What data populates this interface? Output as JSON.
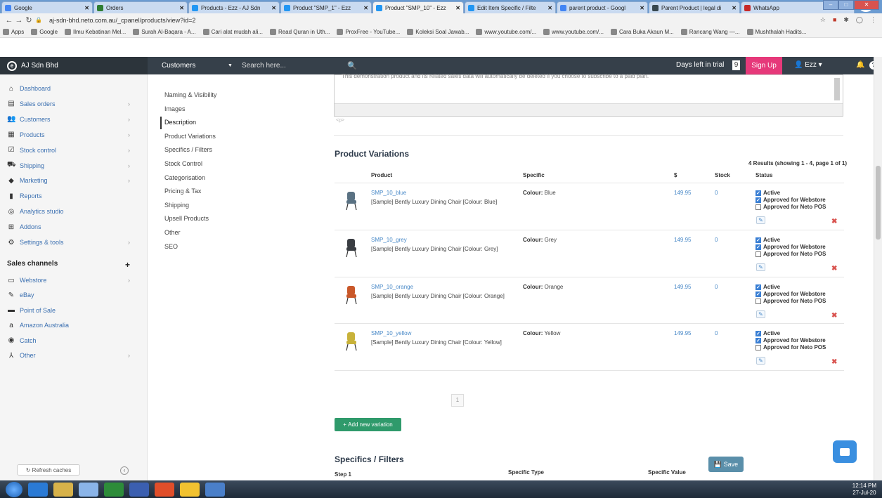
{
  "browser": {
    "tabs": [
      {
        "title": "Google",
        "color": "#4285f4"
      },
      {
        "title": "Orders",
        "color": "#2e7d32"
      },
      {
        "title": "Products - Ezz - AJ Sdn",
        "color": "#2196f3"
      },
      {
        "title": "Product \"SMP_1\" - Ezz",
        "color": "#2196f3"
      },
      {
        "title": "Product \"SMP_10\" - Ezz",
        "color": "#2196f3"
      },
      {
        "title": "Edit Item Specific / Filte",
        "color": "#2196f3"
      },
      {
        "title": "parent product - Googl",
        "color": "#4285f4"
      },
      {
        "title": "Parent Product | legal di",
        "color": "#37474f"
      },
      {
        "title": "WhatsApp",
        "color": "#c62828"
      }
    ],
    "url": "aj-sdn-bhd.neto.com.au/_cpanel/products/view?id=2",
    "bookmarks": [
      "Apps",
      "Google",
      "Ilmu Kebatinan Mel...",
      "Surah Al-Baqara - A...",
      "Cari alat mudah ali...",
      "Read Quran in Uth...",
      "ProxFree - YouTube...",
      "Koleksi Soal Jawab...",
      "www.youtube.com/...",
      "www.youtube.com/...",
      "Cara Buka Akaun M...",
      "Rancang Wang —...",
      "Mushthalah Hadits..."
    ]
  },
  "topnav": {
    "brand": "AJ Sdn Bhd",
    "scope": "Customers",
    "search_placeholder": "Search here...",
    "trial_label": "Days left in trial",
    "trial_days": "9",
    "signup": "Sign Up",
    "user": "Ezz"
  },
  "sidebar": {
    "items": [
      {
        "label": "Dashboard",
        "icon": "home-icon"
      },
      {
        "label": "Sales orders",
        "icon": "document-icon"
      },
      {
        "label": "Customers",
        "icon": "users-icon"
      },
      {
        "label": "Products",
        "icon": "box-icon"
      },
      {
        "label": "Stock control",
        "icon": "check-icon"
      },
      {
        "label": "Shipping",
        "icon": "truck-icon"
      },
      {
        "label": "Marketing",
        "icon": "tag-icon"
      },
      {
        "label": "Reports",
        "icon": "chart-icon"
      },
      {
        "label": "Analytics studio",
        "icon": "analytics-icon"
      },
      {
        "label": "Addons",
        "icon": "plus-square-icon"
      },
      {
        "label": "Settings & tools",
        "icon": "gear-icon"
      }
    ],
    "channels_heading": "Sales channels",
    "channels": [
      {
        "label": "Webstore",
        "icon": "store-icon"
      },
      {
        "label": "eBay",
        "icon": "ebay-icon"
      },
      {
        "label": "Point of Sale",
        "icon": "pos-icon"
      },
      {
        "label": "Amazon Australia",
        "icon": "amazon-icon"
      },
      {
        "label": "Catch",
        "icon": "catch-icon"
      },
      {
        "label": "Other",
        "icon": "other-icon"
      }
    ],
    "refresh": "Refresh caches"
  },
  "section_nav": [
    "Naming & Visibility",
    "Images",
    "Description",
    "Product Variations",
    "Specifics / Filters",
    "Stock Control",
    "Categorisation",
    "Pricing & Tax",
    "Shipping",
    "Upsell Products",
    "Other",
    "SEO"
  ],
  "editor": {
    "text": "This demonstration product and its related sales data will automatically be deleted if you choose to subscribe to a paid plan.",
    "tag": "<p>"
  },
  "variations": {
    "title": "Product Variations",
    "results": "4 Results (showing 1 - 4, page 1 of 1)",
    "headers": {
      "product": "Product",
      "specific": "Specific",
      "price": "$",
      "stock": "Stock",
      "status": "Status"
    },
    "rows": [
      {
        "sku": "SMP_10_blue",
        "name": "[Sample] Bently Luxury Dining Chair [Colour: Blue]",
        "spec_key": "Colour:",
        "spec_val": " Blue",
        "price": "149.95",
        "stock": "0",
        "color": "#5a7283"
      },
      {
        "sku": "SMP_10_grey",
        "name": "[Sample] Bently Luxury Dining Chair [Colour: Grey]",
        "spec_key": "Colour:",
        "spec_val": " Grey",
        "price": "149.95",
        "stock": "0",
        "color": "#3a3d42"
      },
      {
        "sku": "SMP_10_orange",
        "name": "[Sample] Bently Luxury Dining Chair [Colour: Orange]",
        "spec_key": "Colour:",
        "spec_val": " Orange",
        "price": "149.95",
        "stock": "0",
        "color": "#c9582a"
      },
      {
        "sku": "SMP_10_yellow",
        "name": "[Sample] Bently Luxury Dining Chair [Colour: Yellow]",
        "spec_key": "Colour:",
        "spec_val": " Yellow",
        "price": "149.95",
        "stock": "0",
        "color": "#c8b23a"
      }
    ],
    "status_labels": {
      "active": "Active",
      "webstore": "Approved for Webstore",
      "pos": "Approved for Neto POS"
    },
    "page": "1",
    "add_button": "Add new variation"
  },
  "specifics": {
    "title": "Specifics / Filters",
    "step": "Step 1",
    "col_type": "Specific Type",
    "col_value": "Specific Value",
    "save": "Save"
  },
  "taskbar": {
    "time": "12:14 PM",
    "date": "27-Jul-20"
  }
}
